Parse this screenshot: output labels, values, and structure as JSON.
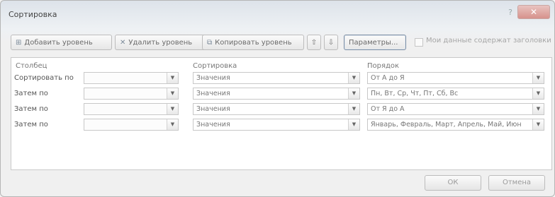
{
  "window": {
    "title": "Сортировка"
  },
  "toolbar": {
    "add_level": "Добавить уровень",
    "delete_level": "Удалить уровень",
    "copy_level": "Копировать уровень",
    "move_up": "⇧",
    "move_down": "⇩",
    "options": "Параметры...",
    "headers_checkbox_label": "Мои данные содержат заголовки"
  },
  "grid": {
    "headers": {
      "column": "Столбец",
      "sort_on": "Сортировка",
      "order": "Порядок"
    },
    "rows": [
      {
        "label": "Сортировать по",
        "column": "",
        "sort_on": "Значения",
        "order": "От А до Я"
      },
      {
        "label": "Затем по",
        "column": "",
        "sort_on": "Значения",
        "order": "Пн, Вт, Ср, Чт, Пт, Сб, Вс"
      },
      {
        "label": "Затем по",
        "column": "",
        "sort_on": "Значения",
        "order": "От Я до А"
      },
      {
        "label": "Затем по",
        "column": "",
        "sort_on": "Значения",
        "order": "Январь, Февраль, Март, Апрель, Май, Июн"
      }
    ]
  },
  "footer": {
    "ok": "ОК",
    "cancel": "Отмена"
  }
}
